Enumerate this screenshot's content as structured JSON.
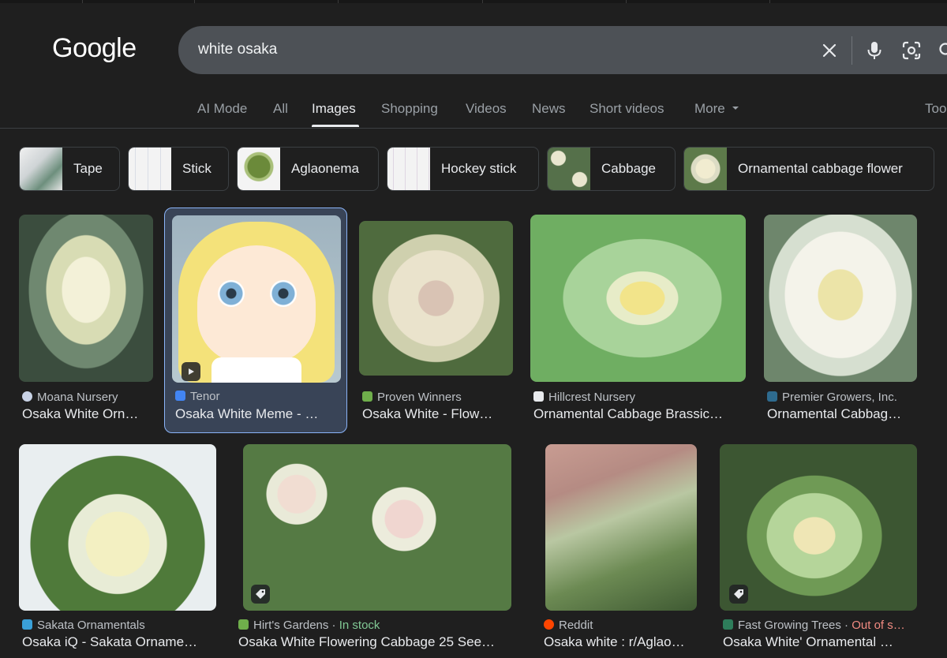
{
  "header": {
    "logo": "Google",
    "search_query": "white osaka"
  },
  "tabs": [
    {
      "label": "AI Mode"
    },
    {
      "label": "All"
    },
    {
      "label": "Images"
    },
    {
      "label": "Shopping"
    },
    {
      "label": "Videos"
    },
    {
      "label": "News"
    },
    {
      "label": "Short videos"
    },
    {
      "label": "More"
    },
    {
      "label": "Too"
    }
  ],
  "chips": [
    {
      "label": "Tape"
    },
    {
      "label": "Stick"
    },
    {
      "label": "Aglaonema"
    },
    {
      "label": "Hockey stick"
    },
    {
      "label": "Cabbage"
    },
    {
      "label": "Ornamental cabbage flower"
    }
  ],
  "results": [
    {
      "source": "Moana Nursery",
      "title": "Osaka White Orn…"
    },
    {
      "source": "Tenor",
      "title": "Osaka White Meme - …"
    },
    {
      "source": "Proven Winners",
      "title": "Osaka White - Flow…"
    },
    {
      "source": "Hillcrest Nursery",
      "title": "Ornamental Cabbage Brassic…"
    },
    {
      "source": "Premier Growers, Inc.",
      "title": "Ornamental Cabbag…"
    },
    {
      "source": "Sakata Ornamentals",
      "title": "Osaka iQ - Sakata Orname…"
    },
    {
      "source": "Hirt's Gardens",
      "status": "In stock",
      "title": "Osaka White Flowering Cabbage 25 See…"
    },
    {
      "source": "Reddit",
      "title": "Osaka white : r/Aglao…"
    },
    {
      "source": "Fast Growing Trees",
      "status": "Out of s…",
      "title": "Osaka White' Ornamental …"
    }
  ],
  "colors": {
    "background": "#1f1f1f",
    "search_box": "#4d5156",
    "selected_card": "#394457",
    "selected_border": "#8ab4f8",
    "in_stock": "#81c995",
    "out_of_stock": "#f28b82"
  },
  "icons": [
    "clear-icon",
    "microphone-icon",
    "lens-icon",
    "search-icon",
    "caret-down-icon",
    "play-icon",
    "tag-icon"
  ]
}
